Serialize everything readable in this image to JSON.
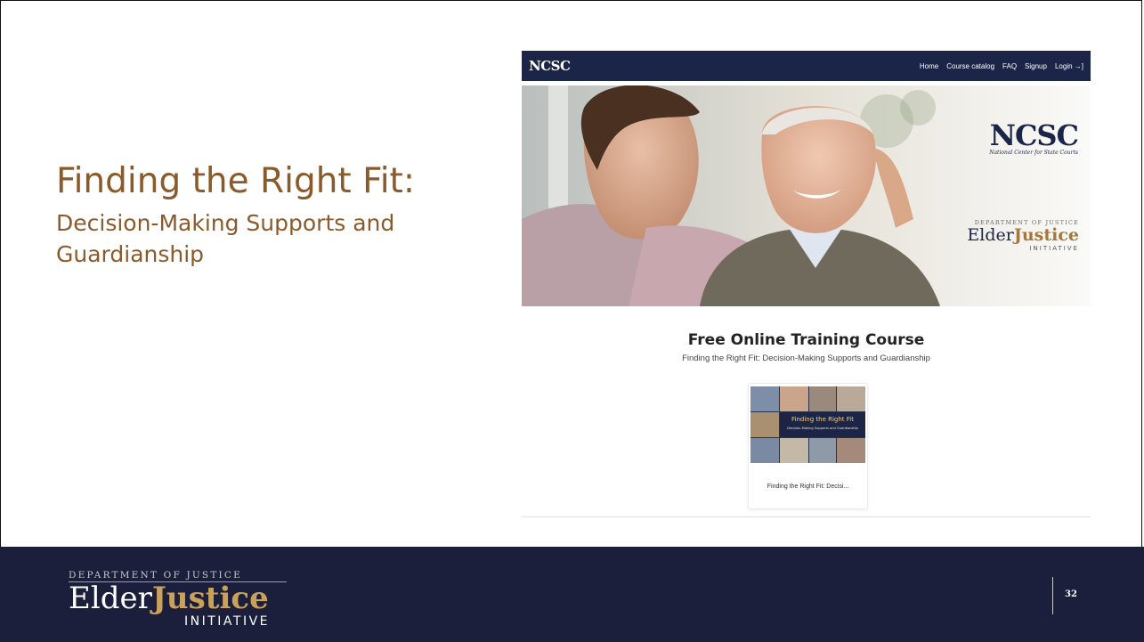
{
  "slide": {
    "title": "Finding the Right Fit:",
    "subtitle": "Decision-Making Supports and Guardianship",
    "page_number": "32"
  },
  "site": {
    "logo": "NCSC",
    "nav": [
      "Home",
      "Course catalog",
      "FAQ",
      "Signup",
      "Login →]"
    ],
    "hero": {
      "ncsc_logo": "NCSC",
      "ncsc_tagline": "National Center for State Courts",
      "doj_top": "DEPARTMENT OF JUSTICE",
      "doj_elder": "Elder",
      "doj_justice": "Justice",
      "doj_initiative": "INITIATIVE"
    },
    "heading": "Free Online Training Course",
    "subheading": "Finding the Right Fit: Decision-Making Supports and Guardianship",
    "course_card": {
      "thumb_title": "Finding the Right Fit",
      "thumb_sub": "Decision-Making Supports and Guardianship",
      "label": "Finding the Right Fit: Decisi..."
    }
  },
  "footer": {
    "doj": "DEPARTMENT OF JUSTICE",
    "elder": "Elder",
    "justice": "Justice",
    "initiative": "INITIATIVE"
  },
  "colors": {
    "title": "#8a5a2b",
    "footer_bg": "#1c1f3c",
    "nav_bg": "#1b2547",
    "gold": "#c9a15a"
  }
}
